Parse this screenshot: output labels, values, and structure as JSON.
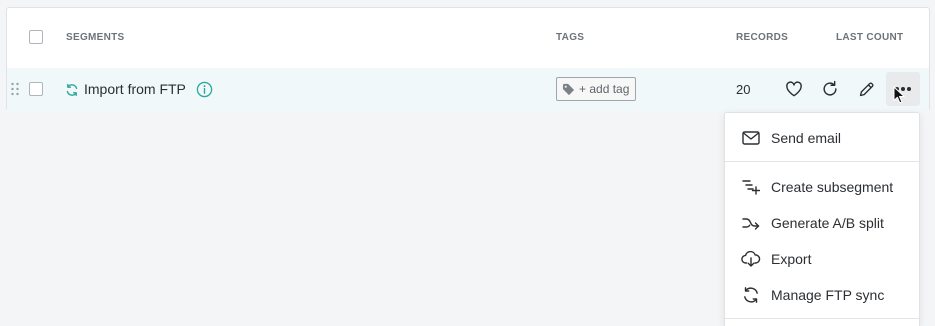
{
  "table": {
    "columns": {
      "segments": "SEGMENTS",
      "tags": "TAGS",
      "records": "RECORDS",
      "last_count": "LAST COUNT"
    },
    "rows": [
      {
        "name": "Import from FTP",
        "tag_button": "+ add tag",
        "records": "20"
      }
    ]
  },
  "menu": {
    "items": [
      {
        "label": "Send email",
        "icon": "envelope-icon"
      },
      {
        "label": "Create subsegment",
        "icon": "subsegment-icon"
      },
      {
        "label": "Generate A/B split",
        "icon": "split-icon"
      },
      {
        "label": "Export",
        "icon": "cloud-download-icon"
      },
      {
        "label": "Manage FTP sync",
        "icon": "sync-icon"
      }
    ]
  },
  "colors": {
    "accent": "#2aa8a0",
    "row_highlight": "#f1f8f9",
    "info": "#2aa8a0"
  }
}
